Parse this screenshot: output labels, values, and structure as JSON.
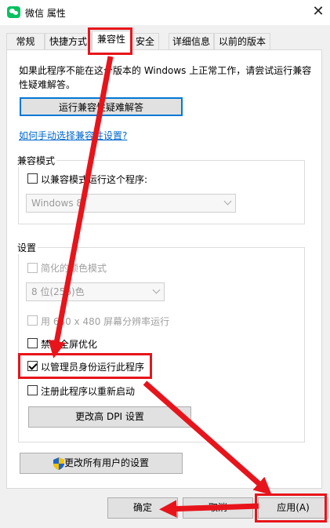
{
  "window": {
    "title": "微信 属性",
    "close_icon": "close-icon",
    "app_icon": "wechat-icon"
  },
  "tabs": [
    {
      "label": "常规",
      "active": false
    },
    {
      "label": "快捷方式",
      "active": false
    },
    {
      "label": "兼容性",
      "active": true
    },
    {
      "label": "安全",
      "active": false
    },
    {
      "label": "详细信息",
      "active": false
    },
    {
      "label": "以前的版本",
      "active": false
    }
  ],
  "compat": {
    "intro": "如果此程序不能在这个版本的 Windows 上正常工作，请尝试运行兼容性疑难解答。",
    "troubleshooter_button": "运行兼容性疑难解答",
    "manual_link": "如何手动选择兼容性设置?"
  },
  "compat_mode": {
    "group_label": "兼容模式",
    "checkbox_label": "以兼容模式运行这个程序:",
    "checked": false,
    "select_value": "Windows 8"
  },
  "settings": {
    "group_label": "设置",
    "reduced_color": {
      "label": "简化的颜色模式",
      "checked": false,
      "enabled": false
    },
    "color_select_value": "8 位(256)色",
    "res_640": {
      "label": "用 640 x 480 屏幕分辨率运行",
      "checked": false,
      "enabled": false
    },
    "disable_fullscreen": {
      "label": "禁用全屏优化",
      "checked": false,
      "enabled": true
    },
    "run_as_admin": {
      "label": "以管理员身份运行此程序",
      "checked": true,
      "enabled": true
    },
    "register_restart": {
      "label": "注册此程序以重新启动",
      "checked": false,
      "enabled": true
    },
    "dpi_button": "更改高 DPI 设置"
  },
  "all_users_button": "更改所有用户的设置",
  "buttons": {
    "ok": "确定",
    "cancel": "取消",
    "apply": "应用(A)"
  },
  "annotation_color": "#e8141b"
}
